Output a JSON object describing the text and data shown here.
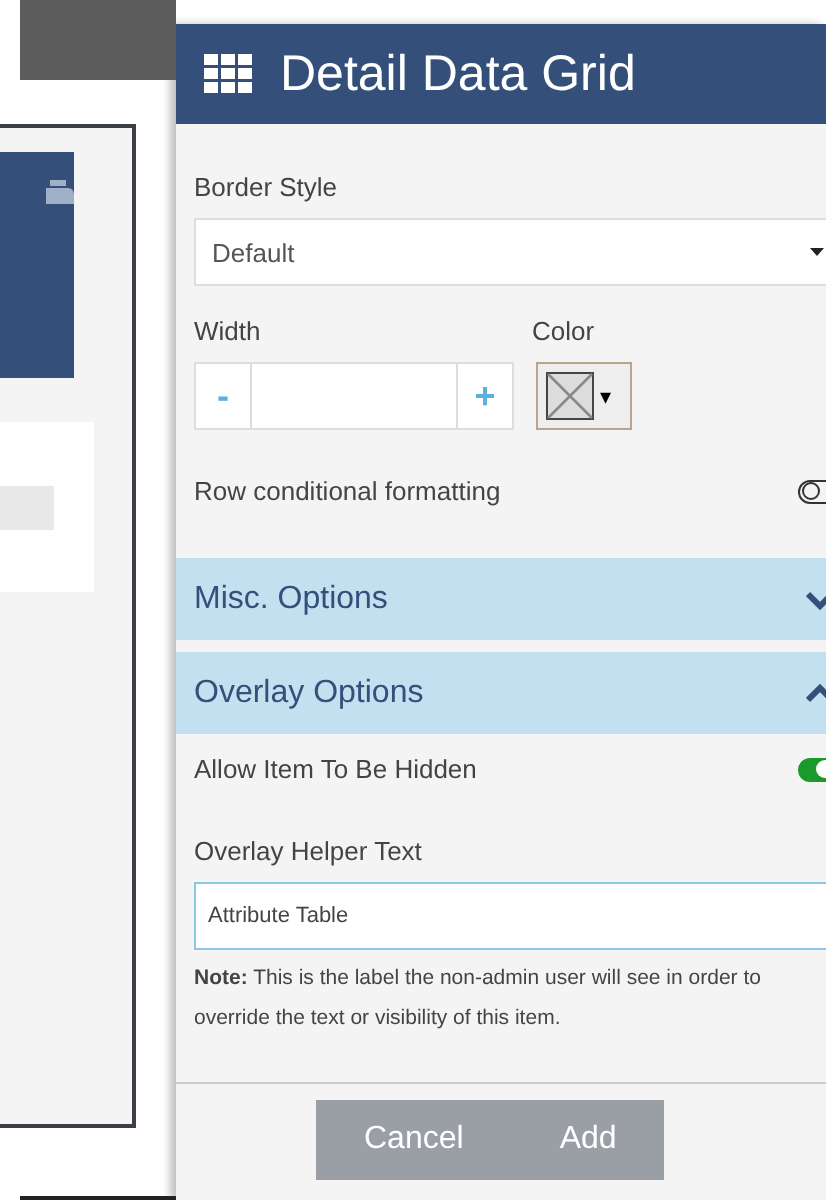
{
  "dialog": {
    "title": "Detail Data Grid"
  },
  "border_style": {
    "label": "Border Style",
    "value": "Default"
  },
  "width": {
    "label": "Width",
    "minus": "-",
    "plus": "+"
  },
  "color": {
    "label": "Color",
    "caret": "▾"
  },
  "row_formatting": {
    "label": "Row conditional formatting",
    "on": false
  },
  "sections": [
    {
      "title": "Misc. Options",
      "expanded": false
    },
    {
      "title": "Overlay Options",
      "expanded": true
    }
  ],
  "allow_hidden": {
    "label": "Allow Item To Be Hidden",
    "on": true
  },
  "helper_text": {
    "label": "Overlay Helper Text",
    "value": "Attribute Table",
    "note": "**Note:** This is the label the non-admin user will see in order to override the text or visibility of this item."
  },
  "buttons": [
    {
      "label": "Cancel"
    },
    {
      "label": "Add"
    }
  ]
}
